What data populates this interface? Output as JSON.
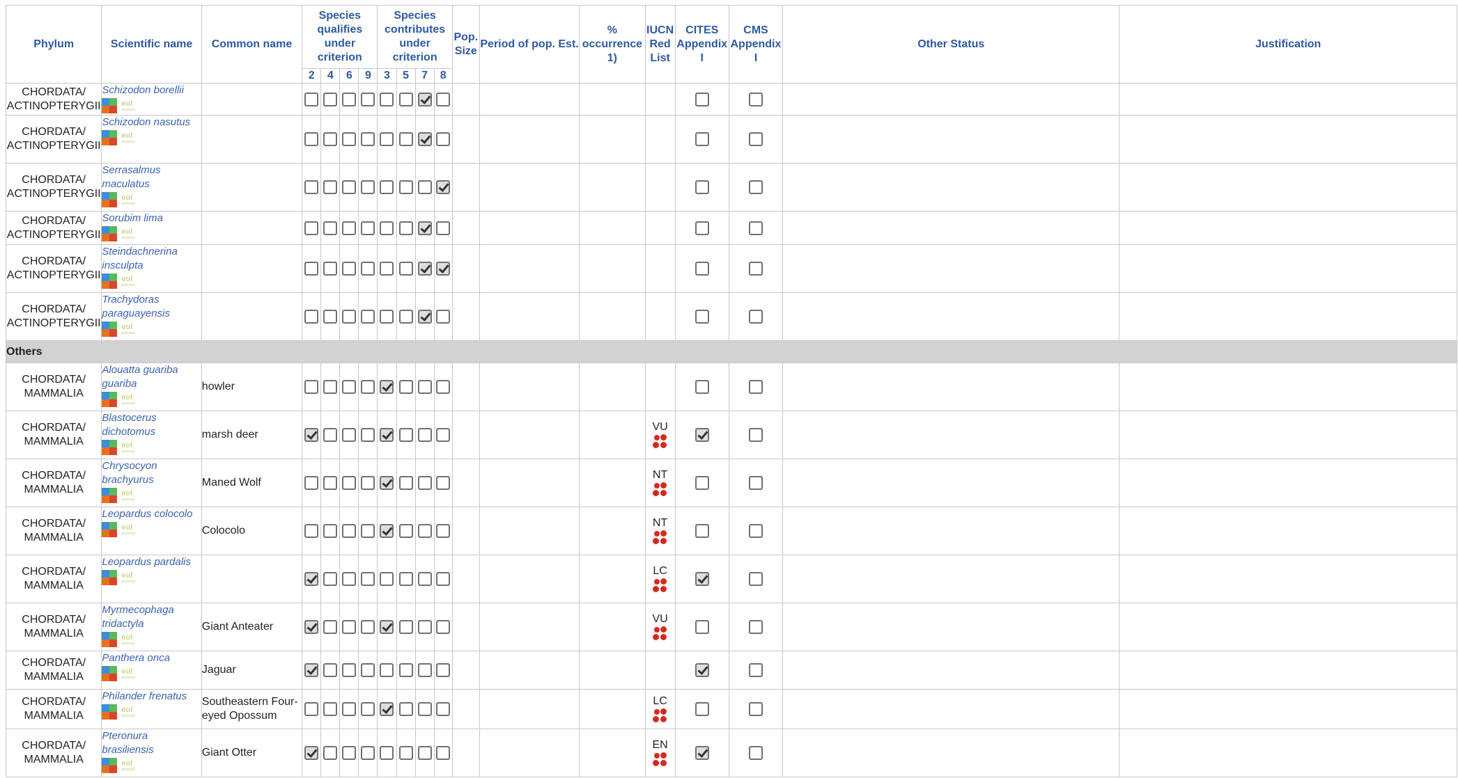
{
  "headers": {
    "phylum": "Phylum",
    "scientific": "Scientific name",
    "common": "Common name",
    "qualifies": "Species qualifies under criterion",
    "contributes": "Species contributes under criterion",
    "pop_size": "Pop. Size",
    "period": "Period of pop. Est.",
    "occurrence": "% occurrence 1)",
    "iucn": "IUCN Red List",
    "cites": "CITES Appendix I",
    "cms": "CMS Appendix I",
    "other": "Other Status",
    "justification": "Justification",
    "qualifies_nums": [
      "2",
      "4",
      "6",
      "9"
    ],
    "contributes_nums": [
      "3",
      "5",
      "7",
      "8"
    ]
  },
  "group_others": "Others",
  "colors": {
    "header_text": "#2e5a9e",
    "sci_text": "#3a62b4",
    "group_bg": "#d2d2d2",
    "redlist": "#d42a1f"
  },
  "icons": [
    "gbif-icon",
    "eol-icon",
    "iucn-redlist-icon",
    "checkbox-icon"
  ],
  "rows": [
    {
      "phylum_a": "CHORDATA/",
      "phylum_b": "ACTINOPTERYGII",
      "sci": "Schizodon borellii",
      "common": "",
      "q": [
        0,
        0,
        0,
        0
      ],
      "c": [
        0,
        0,
        1,
        0
      ],
      "iucn": "",
      "cites": 0,
      "cms": 0
    },
    {
      "phylum_a": "CHORDATA/",
      "phylum_b": "ACTINOPTERYGII",
      "sci": "Schizodon nasutus",
      "common": "",
      "q": [
        0,
        0,
        0,
        0
      ],
      "c": [
        0,
        0,
        1,
        0
      ],
      "iucn": "",
      "cites": 0,
      "cms": 0
    },
    {
      "phylum_a": "CHORDATA/",
      "phylum_b": "ACTINOPTERYGII",
      "sci": "Serrasalmus maculatus",
      "common": "",
      "q": [
        0,
        0,
        0,
        0
      ],
      "c": [
        0,
        0,
        0,
        1
      ],
      "iucn": "",
      "cites": 0,
      "cms": 0
    },
    {
      "phylum_a": "CHORDATA/",
      "phylum_b": "ACTINOPTERYGII",
      "sci": "Sorubim lima",
      "common": "",
      "q": [
        0,
        0,
        0,
        0
      ],
      "c": [
        0,
        0,
        1,
        0
      ],
      "iucn": "",
      "cites": 0,
      "cms": 0
    },
    {
      "phylum_a": "CHORDATA/",
      "phylum_b": "ACTINOPTERYGII",
      "sci": "Steindachnerina insculpta",
      "common": "",
      "q": [
        0,
        0,
        0,
        0
      ],
      "c": [
        0,
        0,
        1,
        1
      ],
      "iucn": "",
      "cites": 0,
      "cms": 0
    },
    {
      "phylum_a": "CHORDATA/",
      "phylum_b": "ACTINOPTERYGII",
      "sci": "Trachydoras paraguayensis",
      "common": "",
      "q": [
        0,
        0,
        0,
        0
      ],
      "c": [
        0,
        0,
        1,
        0
      ],
      "iucn": "",
      "cites": 0,
      "cms": 0
    },
    {
      "group": true
    },
    {
      "phylum_a": "CHORDATA/",
      "phylum_b": "MAMMALIA",
      "sci": "Alouatta guariba guariba",
      "common": "howler",
      "q": [
        0,
        0,
        0,
        0
      ],
      "c": [
        1,
        0,
        0,
        0
      ],
      "iucn": "",
      "cites": 0,
      "cms": 0
    },
    {
      "phylum_a": "CHORDATA/",
      "phylum_b": "MAMMALIA",
      "sci": "Blastocerus dichotomus",
      "common": "marsh deer",
      "q": [
        1,
        0,
        0,
        0
      ],
      "c": [
        1,
        0,
        0,
        0
      ],
      "iucn": "VU",
      "cites": 1,
      "cms": 0
    },
    {
      "phylum_a": "CHORDATA/",
      "phylum_b": "MAMMALIA",
      "sci": "Chrysocyon brachyurus",
      "common": "Maned Wolf",
      "q": [
        0,
        0,
        0,
        0
      ],
      "c": [
        1,
        0,
        0,
        0
      ],
      "iucn": "NT",
      "cites": 0,
      "cms": 0
    },
    {
      "phylum_a": "CHORDATA/",
      "phylum_b": "MAMMALIA",
      "sci": "Leopardus colocolo",
      "common": "Colocolo",
      "q": [
        0,
        0,
        0,
        0
      ],
      "c": [
        1,
        0,
        0,
        0
      ],
      "iucn": "NT",
      "cites": 0,
      "cms": 0
    },
    {
      "phylum_a": "CHORDATA/",
      "phylum_b": "MAMMALIA",
      "sci": "Leopardus pardalis",
      "common": "",
      "q": [
        1,
        0,
        0,
        0
      ],
      "c": [
        0,
        0,
        0,
        0
      ],
      "iucn": "LC",
      "cites": 1,
      "cms": 0
    },
    {
      "phylum_a": "CHORDATA/",
      "phylum_b": "MAMMALIA",
      "sci": "Myrmecophaga tridactyla",
      "common": "Giant Anteater",
      "q": [
        1,
        0,
        0,
        0
      ],
      "c": [
        1,
        0,
        0,
        0
      ],
      "iucn": "VU",
      "cites": 0,
      "cms": 0
    },
    {
      "phylum_a": "CHORDATA/",
      "phylum_b": "MAMMALIA",
      "sci": "Panthera onca",
      "common": "Jaguar",
      "q": [
        1,
        0,
        0,
        0
      ],
      "c": [
        0,
        0,
        0,
        0
      ],
      "iucn": "",
      "cites": 1,
      "cms": 0
    },
    {
      "phylum_a": "CHORDATA/",
      "phylum_b": "MAMMALIA",
      "sci": "Philander frenatus",
      "common": "Southeastern Four-eyed Opossum",
      "q": [
        0,
        0,
        0,
        0
      ],
      "c": [
        1,
        0,
        0,
        0
      ],
      "iucn": "LC",
      "cites": 0,
      "cms": 0
    },
    {
      "phylum_a": "CHORDATA/",
      "phylum_b": "MAMMALIA",
      "sci": "Pteronura brasiliensis",
      "common": "Giant Otter",
      "q": [
        1,
        0,
        0,
        0
      ],
      "c": [
        0,
        0,
        0,
        0
      ],
      "iucn": "EN",
      "cites": 1,
      "cms": 0
    }
  ]
}
